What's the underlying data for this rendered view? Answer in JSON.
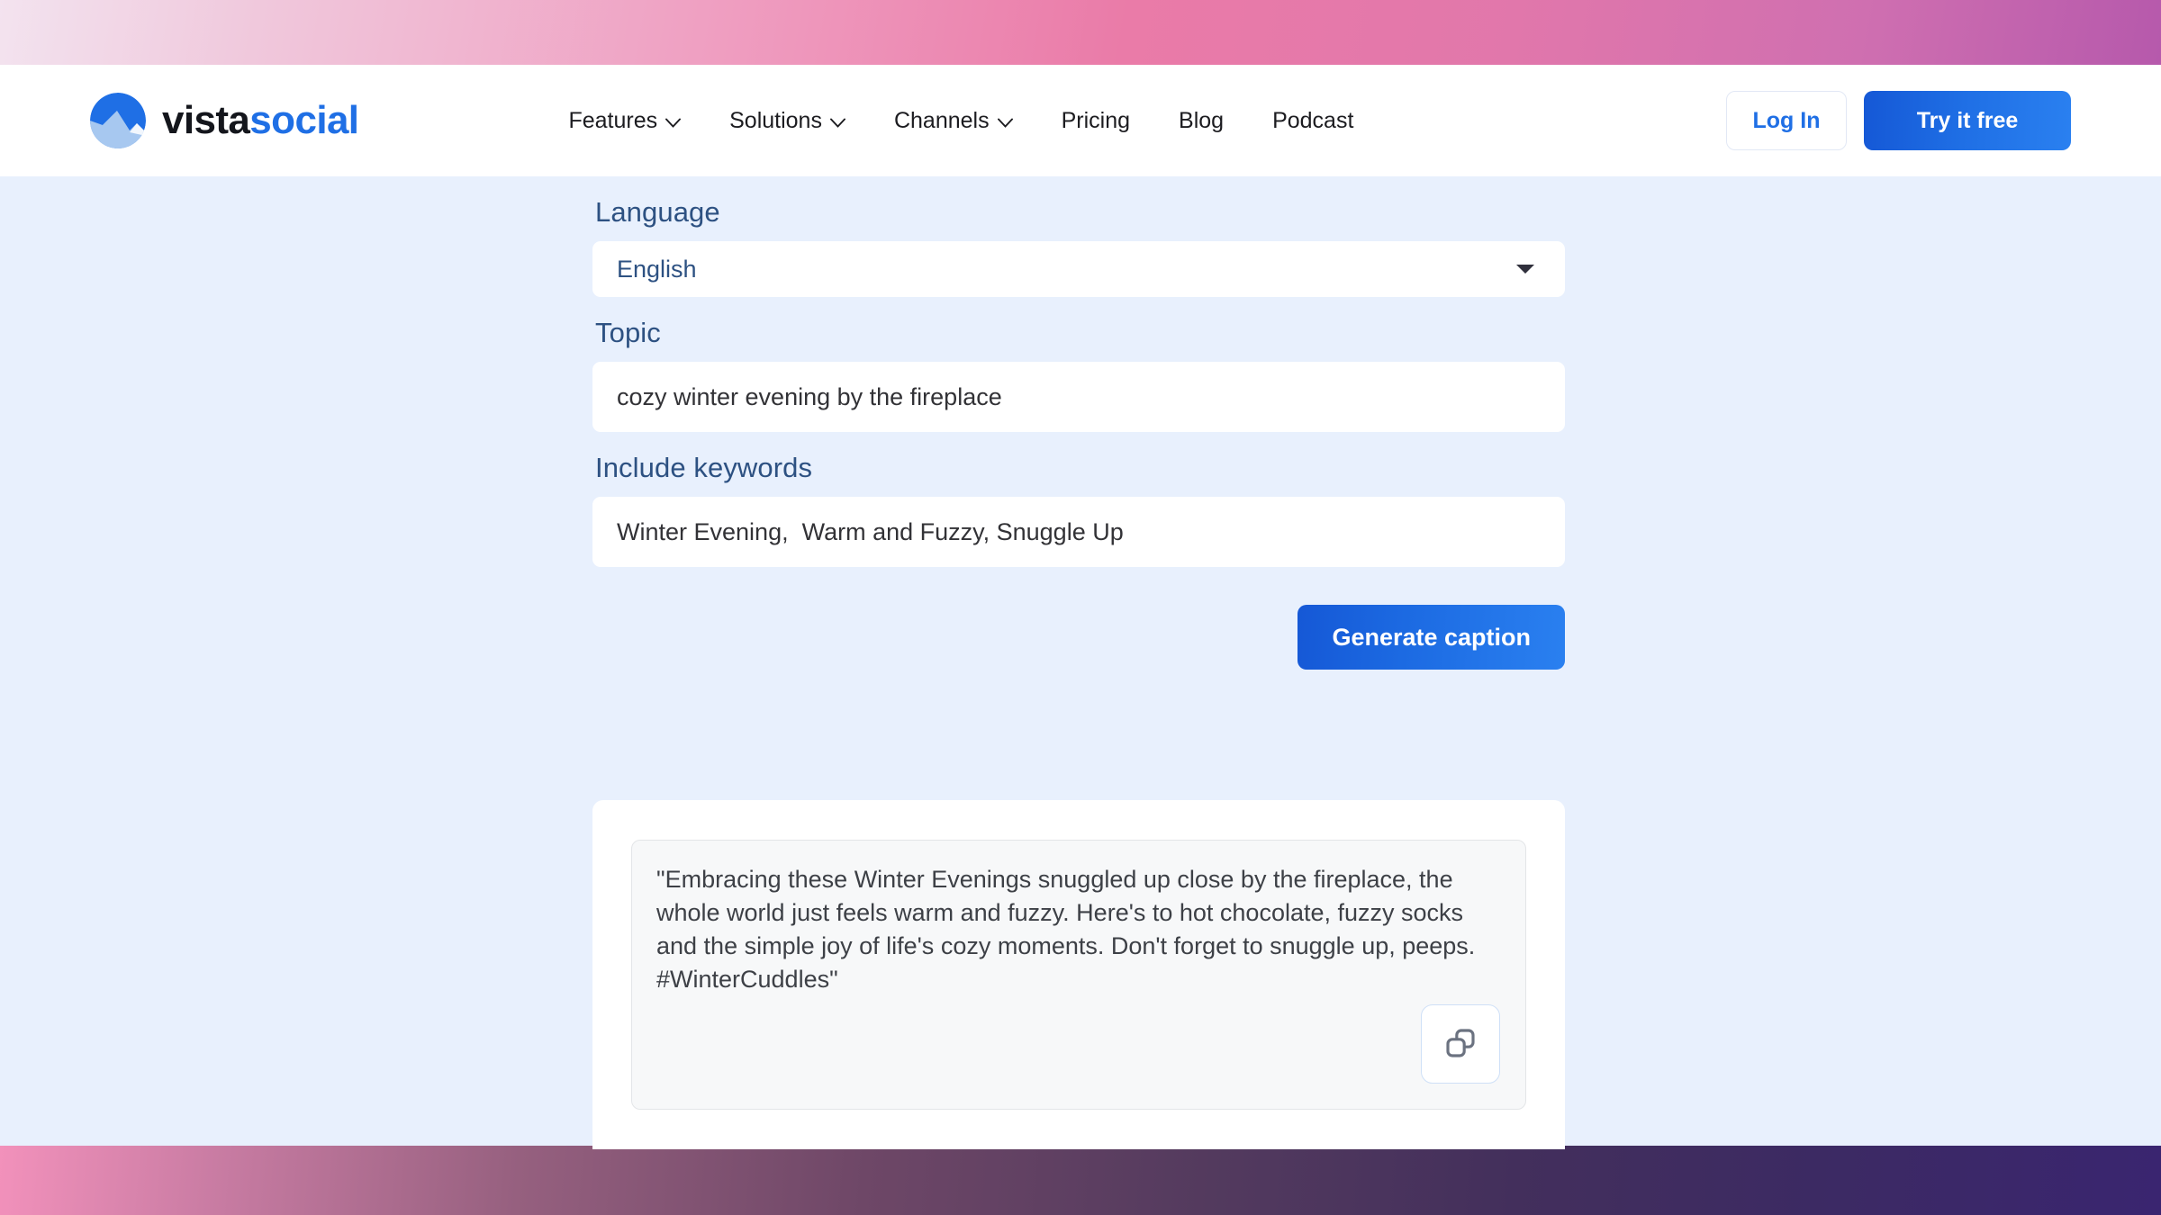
{
  "brand": {
    "name_primary": "vista",
    "name_secondary": "social",
    "logo_icon": "mountain-circle-icon",
    "color_primary": "#14161c",
    "color_secondary": "#1f6fe5"
  },
  "header": {
    "nav": [
      {
        "label": "Features",
        "has_dropdown": true,
        "icon": "chevron-down-icon"
      },
      {
        "label": "Solutions",
        "has_dropdown": true,
        "icon": "chevron-down-icon"
      },
      {
        "label": "Channels",
        "has_dropdown": true,
        "icon": "chevron-down-icon"
      },
      {
        "label": "Pricing",
        "has_dropdown": false
      },
      {
        "label": "Blog",
        "has_dropdown": false
      },
      {
        "label": "Podcast",
        "has_dropdown": false
      }
    ],
    "login_label": "Log In",
    "try_label": "Try it free",
    "accent_color": "#1f6fe5"
  },
  "form": {
    "language": {
      "label": "Language",
      "value": "English",
      "arrow_icon": "caret-down-icon"
    },
    "topic": {
      "label": "Topic",
      "value": "cozy winter evening by the fireplace",
      "placeholder": "Topic"
    },
    "keywords": {
      "label": "Include keywords",
      "value": "Winter Evening,  Warm and Fuzzy, Snuggle Up",
      "placeholder": "Include keywords"
    },
    "generate_label": "Generate caption"
  },
  "result": {
    "caption": "\"Embracing these Winter Evenings snuggled up close by the fireplace, the whole world just feels warm and fuzzy. Here's to hot chocolate, fuzzy socks and the simple joy of life's cozy moments. Don't forget to snuggle up, peeps. #WinterCuddles\"",
    "copy_icon": "copy-icon"
  },
  "theme": {
    "page_background": "#e8f0fd",
    "label_color": "#2d5182",
    "card_background": "#ffffff",
    "result_box_background": "#f7f8f9"
  }
}
